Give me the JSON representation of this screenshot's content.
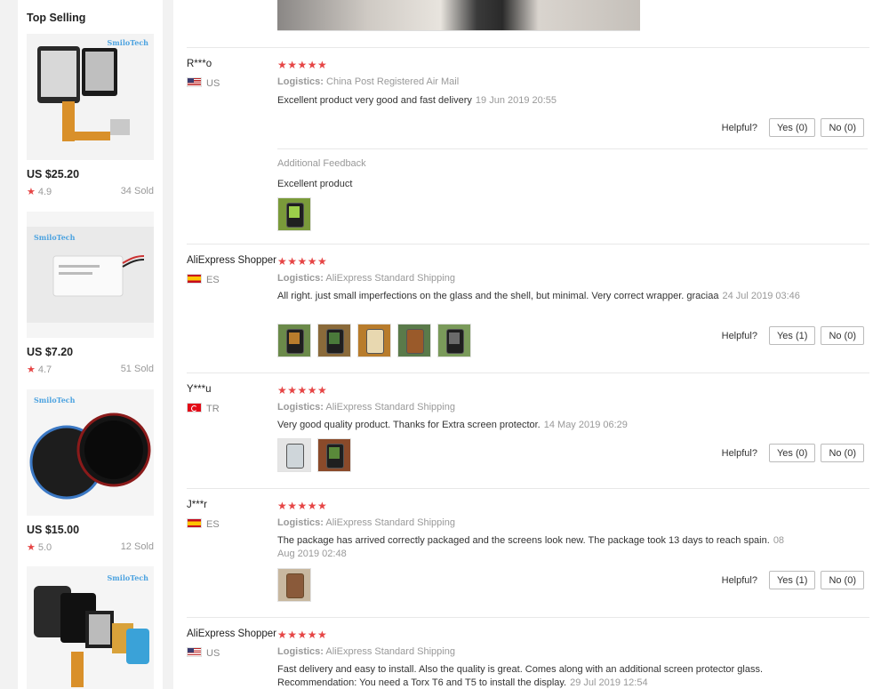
{
  "sidebar": {
    "title": "Top Selling",
    "products": [
      {
        "brand": "SmiloTech",
        "price": "US $25.20",
        "rating": "4.9",
        "sold": "34 Sold"
      },
      {
        "brand": "SmiloTech",
        "price": "US $7.20",
        "rating": "4.7",
        "sold": "51 Sold"
      },
      {
        "brand": "SmiloTech",
        "price": "US $15.00",
        "rating": "5.0",
        "sold": "12 Sold"
      },
      {
        "brand": "SmiloTech",
        "price": "",
        "rating": "",
        "sold": ""
      }
    ]
  },
  "reviews": [
    {
      "reviewer": "R***o",
      "country": "US",
      "stars": "★★★★★",
      "logistics_label": "Logistics:",
      "logistics": "China Post Registered Air Mail",
      "text": "Excellent product very good and fast delivery",
      "time": "19 Jun 2019 20:55",
      "helpful_label": "Helpful?",
      "yes": "Yes (0)",
      "no": "No (0)",
      "additional_title": "Additional Feedback",
      "additional_text": "Excellent product"
    },
    {
      "reviewer": "AliExpress Shopper",
      "country": "ES",
      "stars": "★★★★★",
      "logistics_label": "Logistics:",
      "logistics": "AliExpress Standard Shipping",
      "text": "All right. just small imperfections on the glass and the shell, but minimal. Very correct wrapper. graciaa",
      "time": "24 Jul 2019 03:46",
      "helpful_label": "Helpful?",
      "yes": "Yes (1)",
      "no": "No (0)"
    },
    {
      "reviewer": "Y***u",
      "country": "TR",
      "stars": "★★★★★",
      "logistics_label": "Logistics:",
      "logistics": "AliExpress Standard Shipping",
      "text": "Very good quality product. Thanks for Extra screen protector.",
      "time": "14 May 2019 06:29",
      "helpful_label": "Helpful?",
      "yes": "Yes (0)",
      "no": "No (0)"
    },
    {
      "reviewer": "J***r",
      "country": "ES",
      "stars": "★★★★★",
      "logistics_label": "Logistics:",
      "logistics": "AliExpress Standard Shipping",
      "text": "The package has arrived correctly packaged and the screens look new. The package took 13 days to reach spain.",
      "time": "08 Aug 2019 02:48",
      "helpful_label": "Helpful?",
      "yes": "Yes (1)",
      "no": "No (0)"
    },
    {
      "reviewer": "AliExpress Shopper",
      "country": "US",
      "stars": "★★★★★",
      "logistics_label": "Logistics:",
      "logistics": "AliExpress Standard Shipping",
      "text": "Fast delivery and easy to install. Also the quality is great. Comes along with an additional screen protector glass. Recommendation: You need a Torx T6 and T5 to install the display.",
      "time": "29 Jul 2019 12:54"
    }
  ],
  "colors": {
    "star": "#e64545",
    "muted": "#999999",
    "border": "#e8e8e8"
  }
}
